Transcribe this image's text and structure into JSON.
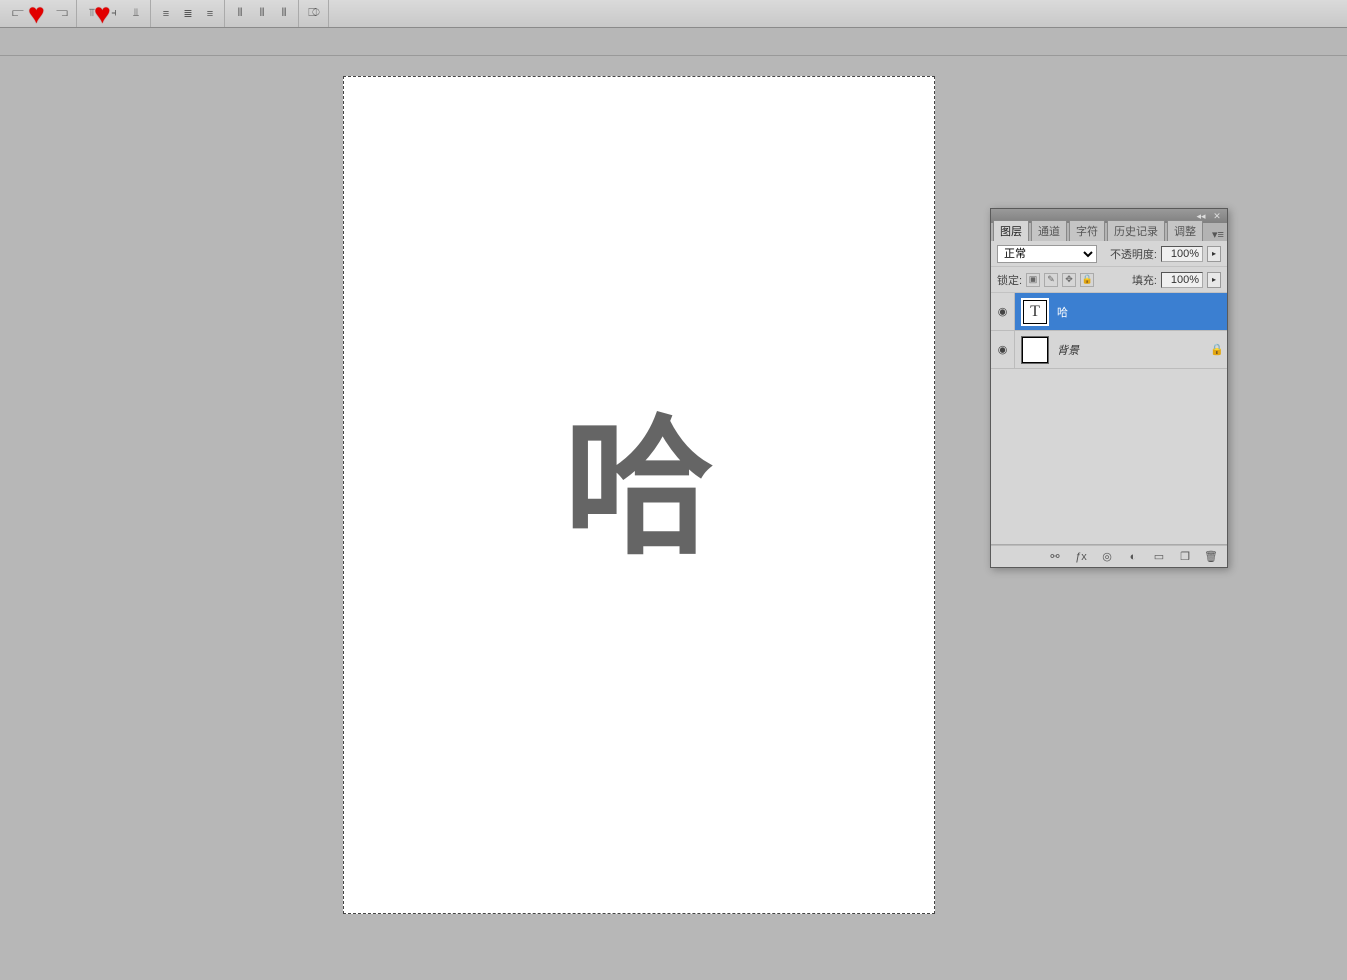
{
  "toolbar": {
    "align_group1": [
      "align-left-edges",
      "align-horizontal-centers",
      "align-right-edges"
    ],
    "align_group2": [
      "align-top-edges",
      "align-vertical-centers",
      "align-bottom-edges"
    ],
    "distribute_group1": [
      "distribute-top",
      "distribute-v-center",
      "distribute-bottom"
    ],
    "distribute_group2": [
      "distribute-left",
      "distribute-h-center",
      "distribute-right"
    ],
    "extra": [
      "auto-align"
    ]
  },
  "annotations": {
    "heart1": "♥",
    "heart2": "♥"
  },
  "canvas": {
    "glyph": "哈"
  },
  "panel": {
    "tabs": [
      "图层",
      "通道",
      "字符",
      "历史记录",
      "调整"
    ],
    "active_tab": 0,
    "blend_label": "正常",
    "opacity_label": "不透明度:",
    "opacity_value": "100%",
    "lock_label": "锁定:",
    "fill_label": "填充:",
    "fill_value": "100%",
    "layers": [
      {
        "name": "哈",
        "type": "text",
        "selected": true,
        "locked": false
      },
      {
        "name": "背景",
        "type": "bg",
        "selected": false,
        "locked": true
      }
    ],
    "footer_icons": [
      "link-icon",
      "fx-icon",
      "mask-icon",
      "adjustment-icon",
      "group-icon",
      "new-layer-icon",
      "trash-icon"
    ]
  }
}
